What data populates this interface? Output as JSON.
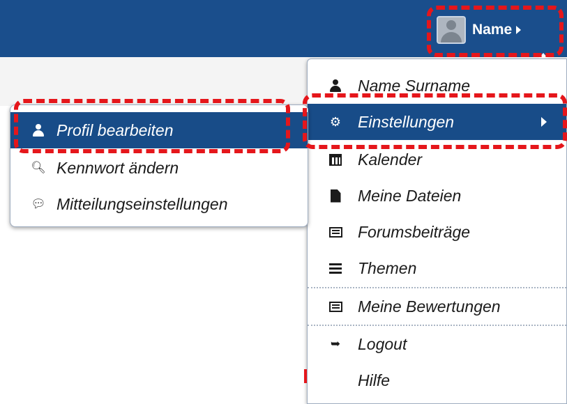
{
  "header": {
    "user_name": "Name",
    "avatar_icon": "user-avatar-icon",
    "bar_color": "#1a4e8c"
  },
  "user_menu": {
    "items": [
      {
        "label": "Name Surname",
        "icon": "user-icon"
      },
      {
        "label": "Einstellungen",
        "icon": "gear-icon",
        "active": true,
        "has_submenu": true
      },
      {
        "label": "Kalender",
        "icon": "calendar-icon"
      },
      {
        "label": "Meine Dateien",
        "icon": "file-icon"
      },
      {
        "label": "Forumsbeiträge",
        "icon": "forum-icon"
      },
      {
        "label": "Themen",
        "icon": "list-icon"
      },
      {
        "label": "Meine Bewertungen",
        "icon": "grades-icon"
      },
      {
        "label": "Logout",
        "icon": "logout-icon"
      },
      {
        "label": "Hilfe",
        "icon": "help-icon"
      }
    ]
  },
  "settings_submenu": {
    "items": [
      {
        "label": "Profil bearbeiten",
        "icon": "user-icon",
        "active": true
      },
      {
        "label": "Kennwort ändern",
        "icon": "key-icon"
      },
      {
        "label": "Mitteilungseinstellungen",
        "icon": "chat-bubbles-icon"
      }
    ]
  },
  "highlight_color": "#e5161b",
  "active_color": "#184c88"
}
